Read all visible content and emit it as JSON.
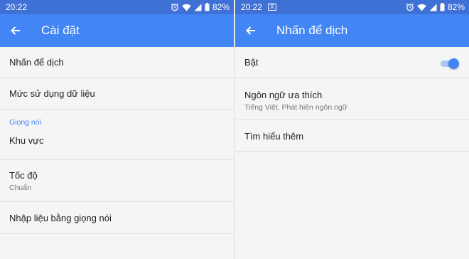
{
  "left": {
    "status": {
      "time": "20:22",
      "battery": "82%"
    },
    "appbar": {
      "title": "Cài đặt"
    },
    "items": [
      {
        "label": "Nhấn để dịch"
      },
      {
        "label": "Mức sử dụng dữ liệu"
      }
    ],
    "section": {
      "header": "Giọng nói"
    },
    "voice_items": [
      {
        "label": "Khu vực"
      },
      {
        "label": "Tốc độ",
        "sub": "Chuẩn"
      },
      {
        "label": "Nhập liệu bằng giọng nói"
      }
    ]
  },
  "right": {
    "status": {
      "time": "20:22",
      "battery": "82%"
    },
    "appbar": {
      "title": "Nhấn để dịch"
    },
    "toggle_row": {
      "label": "Bật",
      "enabled": true
    },
    "language_row": {
      "label": "Ngôn ngữ ưa thích",
      "sub": "Tiếng Việt, Phát hiện ngôn ngữ"
    },
    "learn_more": {
      "label": "Tìm hiểu thêm"
    }
  },
  "colors": {
    "statusbar": "#3f70d6",
    "appbar": "#4285f4",
    "accent": "#4285f4",
    "background": "#f5f5f5"
  },
  "icons": [
    "back-arrow-icon",
    "alarm-icon",
    "wifi-icon",
    "signal-icon",
    "battery-icon",
    "translate-icon"
  ]
}
